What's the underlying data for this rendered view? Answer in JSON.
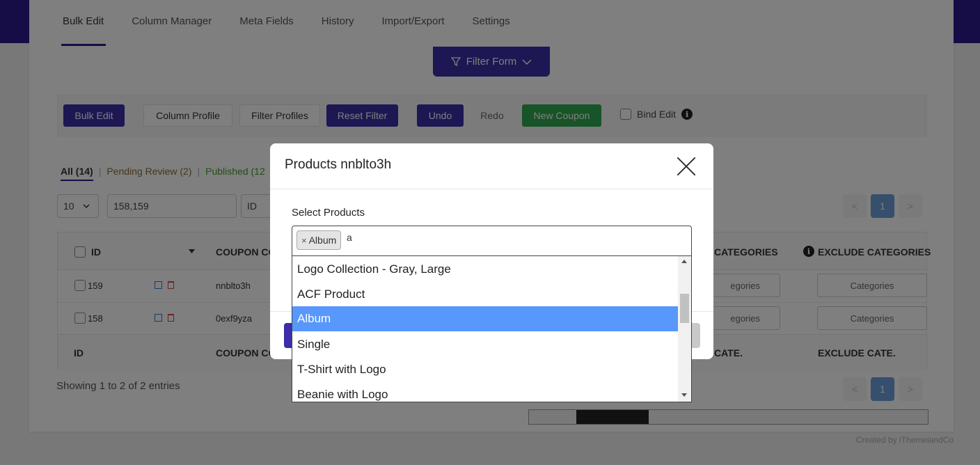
{
  "tabs": [
    "Bulk Edit",
    "Column Manager",
    "Meta Fields",
    "History",
    "Import/Export",
    "Settings"
  ],
  "filter_form": {
    "label": "Filter Form"
  },
  "toolbar": {
    "bulk_edit": "Bulk Edit",
    "column_profile": "Column Profile",
    "filter_profiles": "Filter Profiles",
    "reset_filter": "Reset Filter",
    "undo": "Undo",
    "redo": "Redo",
    "new_coupon": "New Coupon",
    "bind_edit": "Bind Edit"
  },
  "status": {
    "all": "All (14)",
    "pending": "Pending Review (2)",
    "published": "Published (12",
    "sep": "|"
  },
  "filters": {
    "per_page": "10",
    "ids_value": "158,159",
    "field": "ID"
  },
  "pager": {
    "prev": "<",
    "current": "1",
    "next": ">"
  },
  "table": {
    "headers": {
      "id": "ID",
      "coupon_code": "COUPON CO",
      "categories": "CATEGORIES",
      "exclude_categories": "EXCLUDE CATEGORIES"
    },
    "footers": {
      "id": "ID",
      "coupon_code": "COUPON CO",
      "categories": "CATE.",
      "exclude_categories": "EXCLUDE CATE."
    },
    "rows": [
      {
        "id": "159",
        "code": "nnblto3h",
        "categories": "egories",
        "exclude": "Categories"
      },
      {
        "id": "158",
        "code": "0exf9yza",
        "categories": "egories",
        "exclude": "Categories"
      }
    ]
  },
  "showing": "Showing 1 to 2 of 2 entries",
  "credit": "Created by iThemelandCo",
  "modal": {
    "title": "Products nnblto3h",
    "field_label": "Select Products",
    "selected_tag": "Album",
    "tag_remove": "×",
    "search_value": "a",
    "options": [
      {
        "label": "Logo Collection - Gray, Large",
        "highlighted": false
      },
      {
        "label": "ACF Product",
        "highlighted": false
      },
      {
        "label": "Album",
        "highlighted": true
      },
      {
        "label": "Single",
        "highlighted": false
      },
      {
        "label": "T-Shirt with Logo",
        "highlighted": false
      },
      {
        "label": "Beanie with Logo",
        "highlighted": false
      }
    ]
  },
  "colors": {
    "brand": "#2d1b8f",
    "primary_button": "#3b2ea8",
    "highlight": "#5897fb",
    "green": "#2fa84f"
  }
}
